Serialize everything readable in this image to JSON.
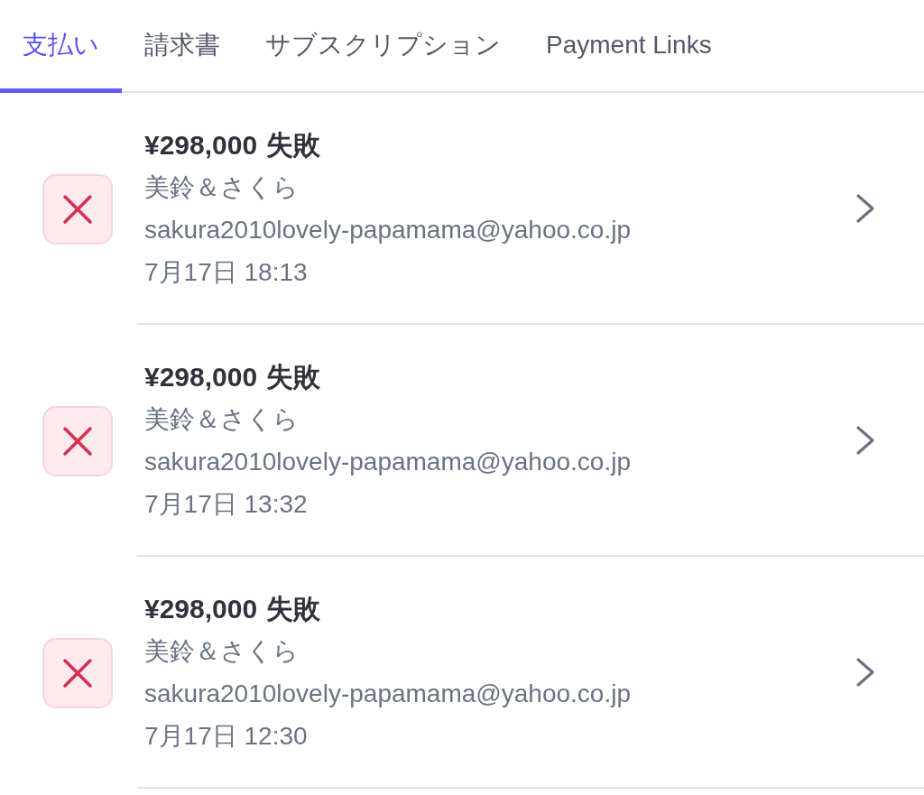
{
  "tabs": [
    {
      "label": "支払い",
      "selected": true
    },
    {
      "label": "請求書",
      "selected": false
    },
    {
      "label": "サブスクリプション",
      "selected": false
    },
    {
      "label": "Payment Links",
      "selected": false
    }
  ],
  "payments": [
    {
      "amount": "¥298,000",
      "status": "失敗",
      "customer": "美鈴＆さくら",
      "email": "sakura2010lovely-papamama@yahoo.co.jp",
      "date": "7月17日 18:13"
    },
    {
      "amount": "¥298,000",
      "status": "失敗",
      "customer": "美鈴＆さくら",
      "email": "sakura2010lovely-papamama@yahoo.co.jp",
      "date": "7月17日 13:32"
    },
    {
      "amount": "¥298,000",
      "status": "失敗",
      "customer": "美鈴＆さくら",
      "email": "sakura2010lovely-papamama@yahoo.co.jp",
      "date": "7月17日 12:30"
    }
  ]
}
